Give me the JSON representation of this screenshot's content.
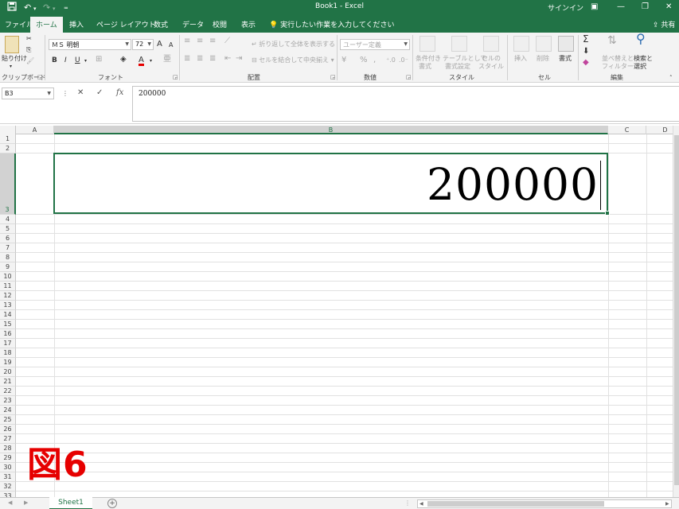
{
  "titlebar": {
    "save_icon": "save-icon",
    "undo_icon": "undo-icon",
    "redo_icon": "redo-icon",
    "title": "Book1  -  Excel",
    "signin": "サインイン"
  },
  "tabs": {
    "items": [
      "ファイル",
      "ホーム",
      "挿入",
      "ページ レイアウト",
      "数式",
      "データ",
      "校閲",
      "表示"
    ],
    "active": "ホーム",
    "tellme": "実行したい作業を入力してください",
    "share": "共有"
  },
  "ribbon": {
    "clipboard": {
      "label": "クリップボード",
      "paste": "貼り付け"
    },
    "font": {
      "label": "フォント",
      "name": "ＭＳ 明朝",
      "size": "72",
      "grow": "A",
      "shrink": "A",
      "bold": "B",
      "italic": "I",
      "underline": "U",
      "color": "A",
      "color_hex": "#e60000"
    },
    "alignment": {
      "label": "配置",
      "wrap": "折り返して全体を表示する",
      "merge": "セルを結合して中央揃え"
    },
    "number": {
      "label": "数値",
      "format": "ユーザー定義",
      "percent": "%",
      "comma": ","
    },
    "styles": {
      "label": "スタイル",
      "conditional_1": "条件付き",
      "conditional_2": "書式",
      "table_1": "テーブルとして",
      "table_2": "書式設定",
      "cell_1": "セルの",
      "cell_2": "スタイル"
    },
    "cells": {
      "label": "セル",
      "insert": "挿入",
      "delete": "削除",
      "format": "書式"
    },
    "editing": {
      "label": "編集",
      "sum": "Σ",
      "sort_1": "並べ替えと",
      "sort_2": "フィルター",
      "find_1": "検索と",
      "find_2": "選択"
    }
  },
  "formula_bar": {
    "name_box": "B3",
    "cancel": "✕",
    "enter": "✓",
    "fx": "fx",
    "value": "200000"
  },
  "grid": {
    "columns": [
      "A",
      "B",
      "C",
      "D"
    ],
    "selected_column": "B",
    "selected_row": "3",
    "active_value": "200000",
    "rows": [
      "1",
      "2",
      "3",
      "4",
      "5",
      "6",
      "7",
      "8",
      "9",
      "10",
      "11",
      "12",
      "13",
      "14",
      "15",
      "16",
      "17",
      "18",
      "19",
      "20",
      "21",
      "22",
      "23",
      "24",
      "25",
      "26",
      "27",
      "28",
      "29",
      "30",
      "31",
      "32",
      "33"
    ]
  },
  "sheets": {
    "tabs": [
      "Sheet1"
    ],
    "add": "+"
  },
  "figure_label": "図6",
  "colors": {
    "accent": "#217346",
    "figure_label": "#e60000"
  }
}
